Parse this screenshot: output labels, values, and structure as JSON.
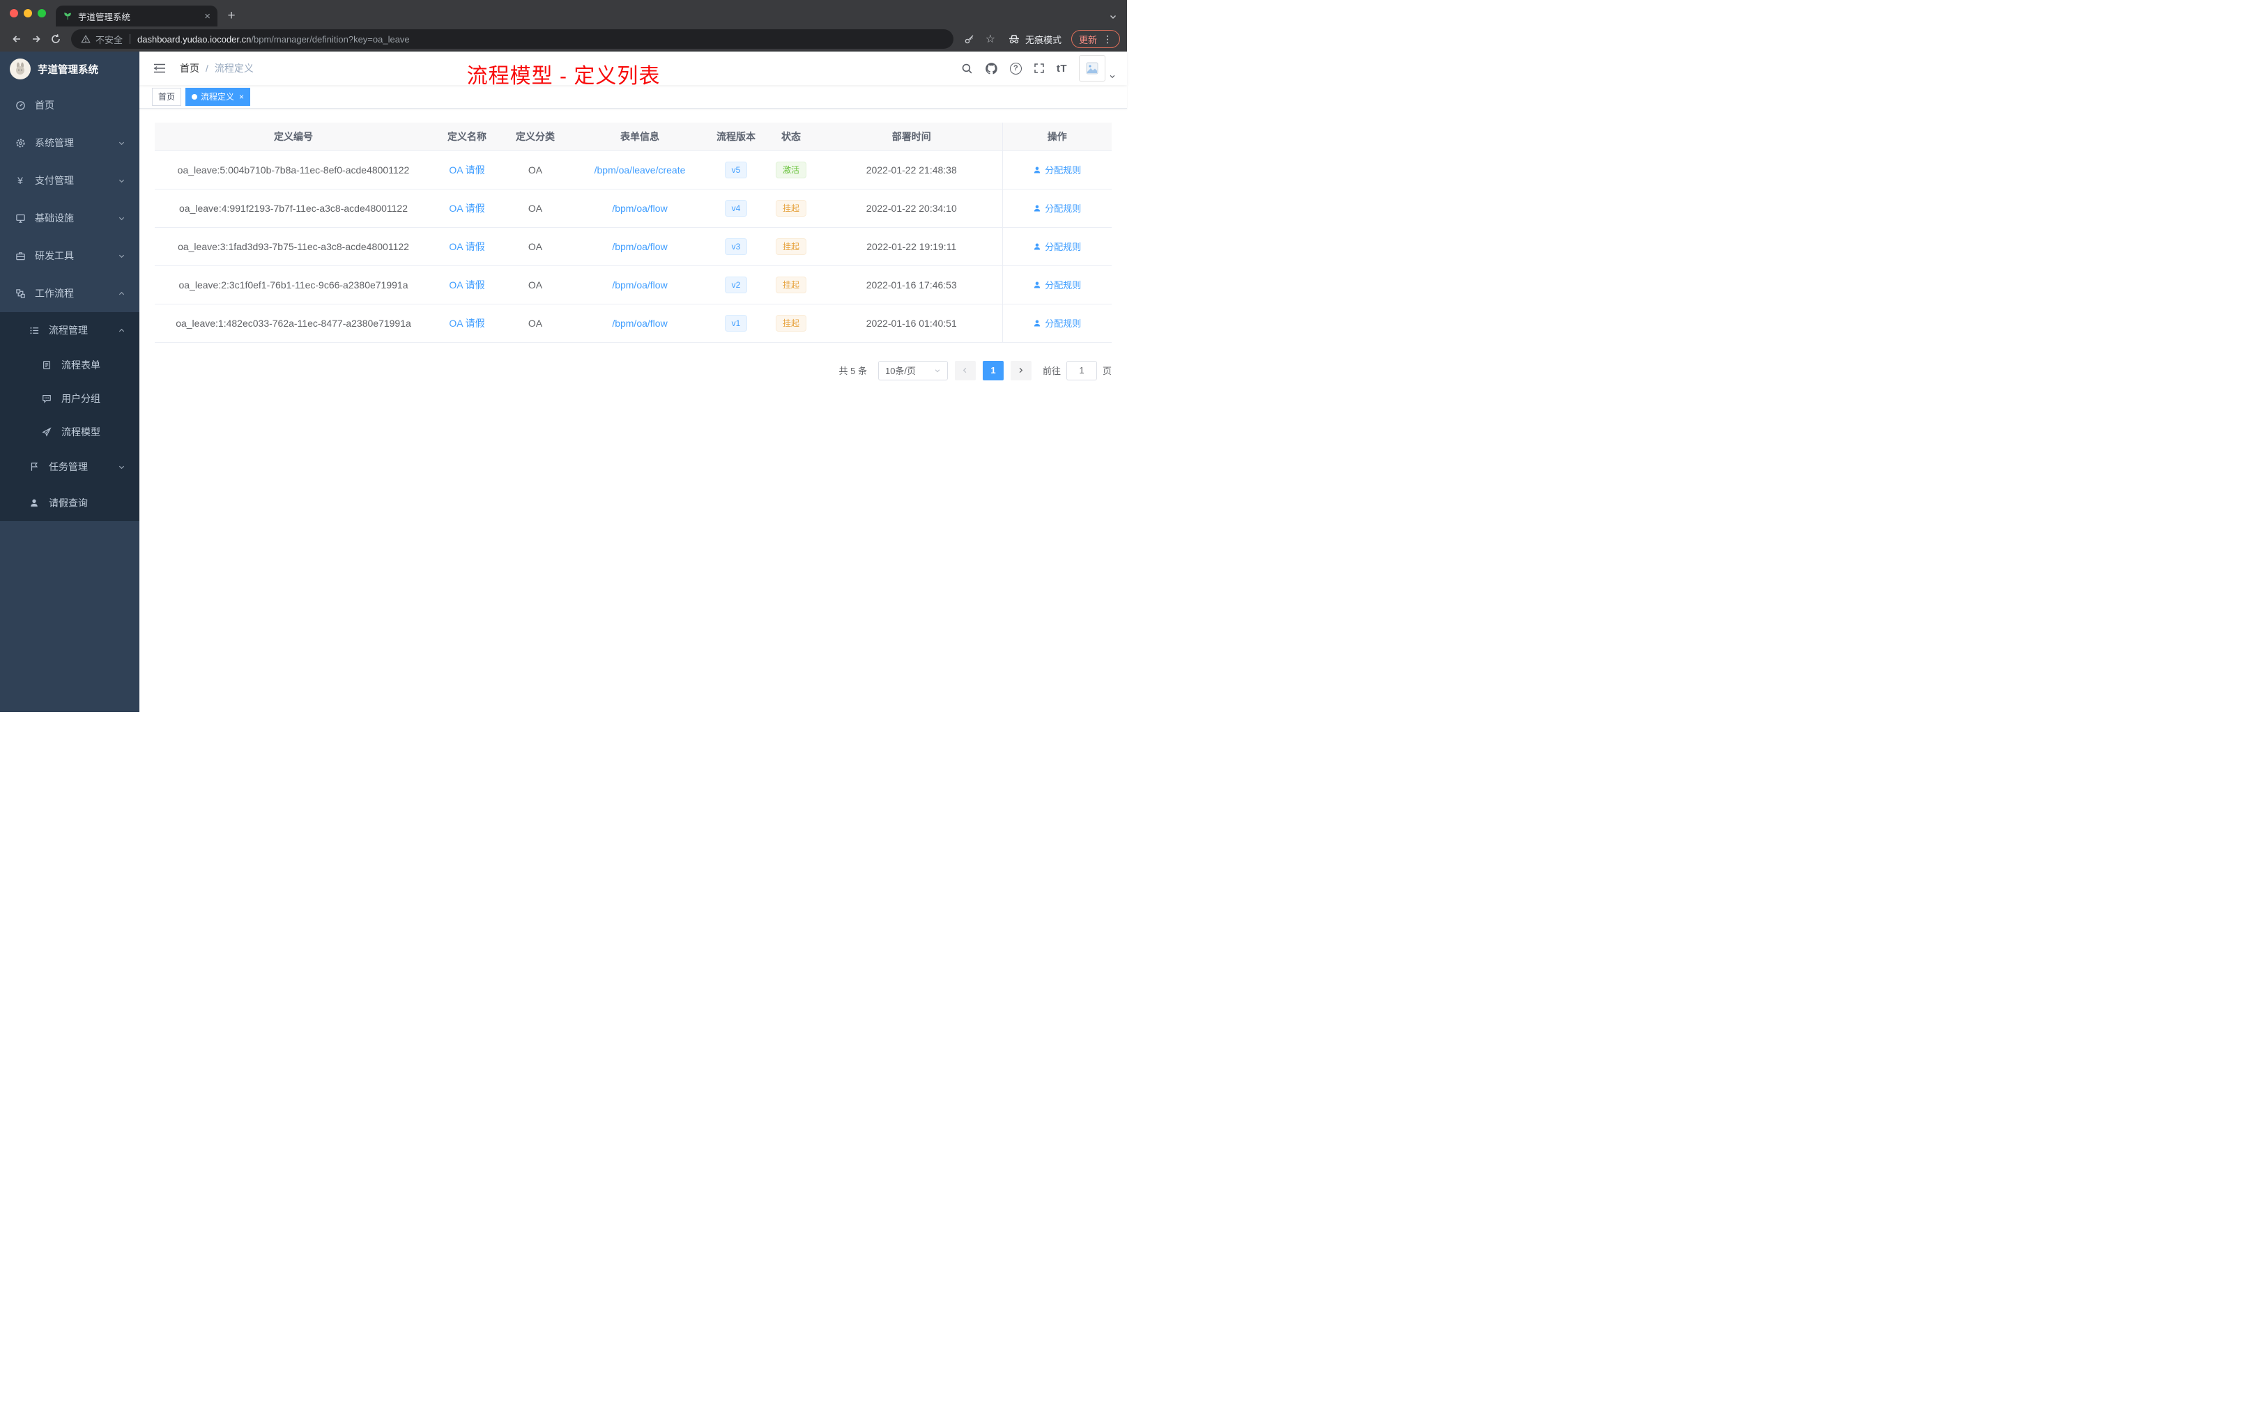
{
  "browser": {
    "tab_title": "芋道管理系统",
    "security_label": "不安全",
    "url_host": "dashboard.yudao.iocoder.cn",
    "url_path": "/bpm/manager/definition?key=oa_leave",
    "incognito_label": "无痕模式",
    "update_label": "更新"
  },
  "icons": {
    "close": "×",
    "plus": "+",
    "more": "⋮",
    "star": "☆",
    "yen": "¥",
    "question": "?",
    "font_size": "tT"
  },
  "sidebar": {
    "logo_title": "芋道管理系统",
    "items": {
      "home": "首页",
      "system": "系统管理",
      "payment": "支付管理",
      "infra": "基础设施",
      "devtools": "研发工具",
      "workflow": "工作流程",
      "process_mgmt": "流程管理",
      "process_form": "流程表单",
      "user_group": "用户分组",
      "process_model": "流程模型",
      "task_mgmt": "任务管理",
      "leave_query": "请假查询"
    }
  },
  "header": {
    "breadcrumb_home": "首页",
    "breadcrumb_sep": "/",
    "breadcrumb_current": "流程定义",
    "annotation": "流程模型 - 定义列表"
  },
  "tags": {
    "home": "首页",
    "active": "流程定义"
  },
  "table": {
    "columns": [
      "定义编号",
      "定义名称",
      "定义分类",
      "表单信息",
      "流程版本",
      "状态",
      "部署时间",
      "操作"
    ],
    "rows": [
      {
        "id": "oa_leave:5:004b710b-7b8a-11ec-8ef0-acde48001122",
        "name": "OA 请假",
        "category": "OA",
        "form": "/bpm/oa/leave/create",
        "version": "v5",
        "status": "激活",
        "time": "2022-01-22 21:48:38",
        "action": "分配规则"
      },
      {
        "id": "oa_leave:4:991f2193-7b7f-11ec-a3c8-acde48001122",
        "name": "OA 请假",
        "category": "OA",
        "form": "/bpm/oa/flow",
        "version": "v4",
        "status": "挂起",
        "time": "2022-01-22 20:34:10",
        "action": "分配规则"
      },
      {
        "id": "oa_leave:3:1fad3d93-7b75-11ec-a3c8-acde48001122",
        "name": "OA 请假",
        "category": "OA",
        "form": "/bpm/oa/flow",
        "version": "v3",
        "status": "挂起",
        "time": "2022-01-22 19:19:11",
        "action": "分配规则"
      },
      {
        "id": "oa_leave:2:3c1f0ef1-76b1-11ec-9c66-a2380e71991a",
        "name": "OA 请假",
        "category": "OA",
        "form": "/bpm/oa/flow",
        "version": "v2",
        "status": "挂起",
        "time": "2022-01-16 17:46:53",
        "action": "分配规则"
      },
      {
        "id": "oa_leave:1:482ec033-762a-11ec-8477-a2380e71991a",
        "name": "OA 请假",
        "category": "OA",
        "form": "/bpm/oa/flow",
        "version": "v1",
        "status": "挂起",
        "time": "2022-01-16 01:40:51",
        "action": "分配规则"
      }
    ]
  },
  "pagination": {
    "total": "共 5 条",
    "page_size": "10条/页",
    "current_page": "1",
    "goto_label": "前往",
    "goto_value": "1",
    "unit_label": "页"
  },
  "colors": {
    "accent": "#409eff",
    "success": "#67c23a",
    "warning": "#e6a23c",
    "annotation_red": "#f80b0b",
    "sidebar_bg": "#304156",
    "submenu_bg": "#1f2d3d"
  }
}
